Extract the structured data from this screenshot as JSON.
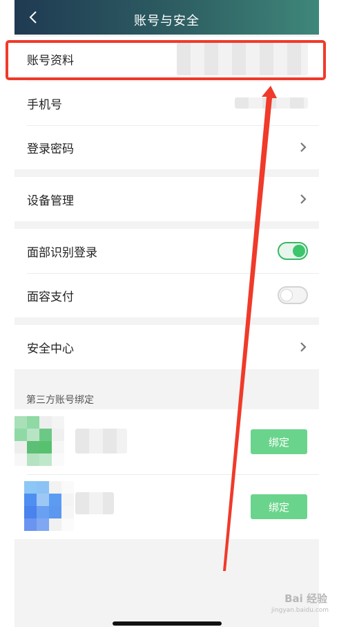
{
  "header": {
    "title": "账号与安全"
  },
  "rows": {
    "account_info": "账号资料",
    "phone": "手机号",
    "login_password": "登录密码",
    "device_management": "设备管理",
    "face_login": "面部识别登录",
    "face_pay": "面容支付",
    "security_center": "安全中心"
  },
  "toggles": {
    "face_login_on": true,
    "face_pay_on": false
  },
  "third_party": {
    "section_title": "第三方账号绑定",
    "bind_label": "绑定"
  },
  "watermark": {
    "main": "Bai 经验",
    "sub": "jingyan.baidu.com"
  },
  "colors": {
    "accent_green": "#37b865",
    "highlight_red": "#f03a2a",
    "header_start": "#1f3a52",
    "header_end": "#3f877a"
  }
}
